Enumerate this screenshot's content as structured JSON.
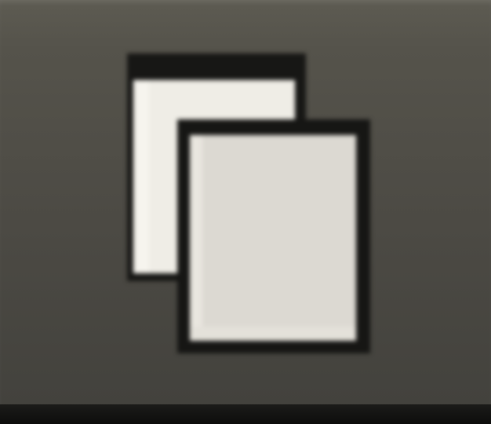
{
  "toolbar_button": {
    "icon": "copy-icon",
    "colors": {
      "button_top": "#5d5b52",
      "button_bottom": "#43423d",
      "page_back": "#efede6",
      "page_front": "#dcd9d2",
      "outline": "#171715",
      "bottom_edge": "#111110"
    }
  }
}
